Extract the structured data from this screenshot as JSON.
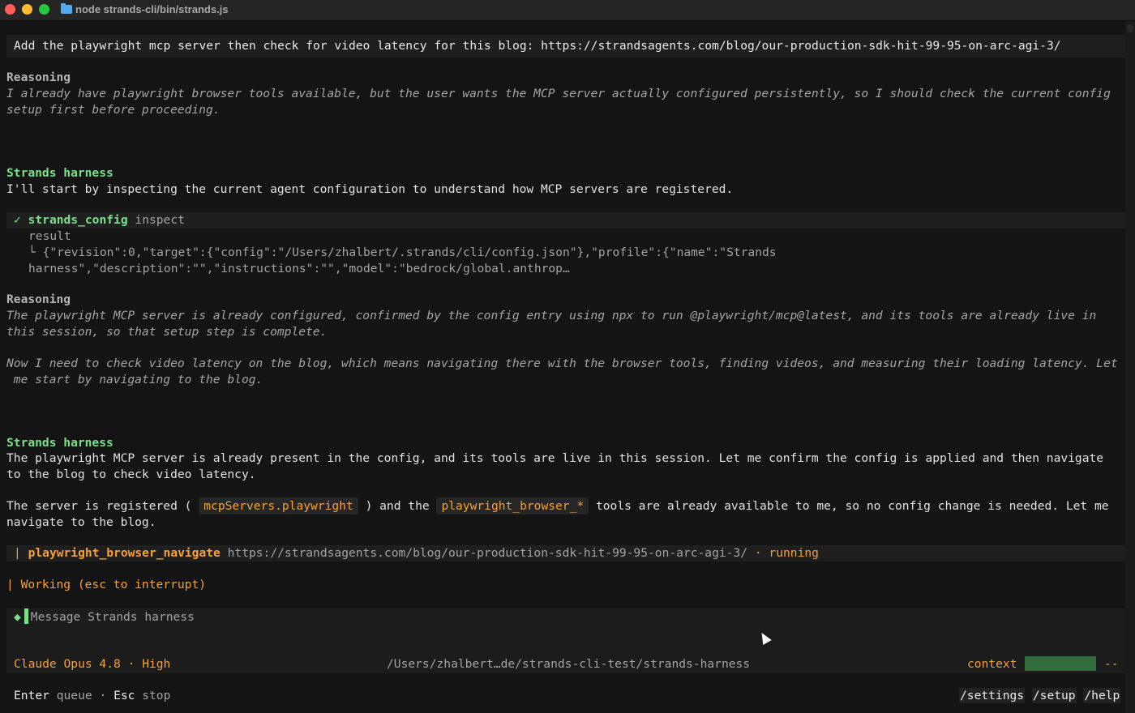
{
  "window": {
    "title": "node strands-cli/bin/strands.js",
    "folder_icon": "folder-icon"
  },
  "conversation": {
    "user_prompt": "Add the playwright mcp server then check for video latency for this blog: https://strandsagents.com/blog/our-production-sdk-hit-99-95-on-arc-agi-3/",
    "reasoning_1": {
      "heading": "Reasoning",
      "lines": [
        "I already have playwright browser tools available, but the user wants the MCP server actually configured persistently, so I should check the current config",
        "setup first before proceeding."
      ]
    },
    "agent_1": {
      "name": "Strands harness",
      "text": "I'll start by inspecting the current agent configuration to understand how MCP servers are registered."
    },
    "tool_1": {
      "check": "✓",
      "name": "strands_config",
      "action": "inspect",
      "result_label": "result",
      "corner": "└",
      "result_lines": [
        "{\"revision\":0,\"target\":{\"config\":\"/Users/zhalbert/.strands/cli/config.json\"},\"profile\":{\"name\":\"Strands",
        "harness\",\"description\":\"\",\"instructions\":\"\",\"model\":\"bedrock/global.anthrop…"
      ]
    },
    "reasoning_2": {
      "heading": "Reasoning",
      "lines": [
        "The playwright MCP server is already configured, confirmed by the config entry using npx to run @playwright/mcp@latest, and its tools are already live in",
        "this session, so that setup step is complete.",
        "Now I need to check video latency on the blog, which means navigating there with the browser tools, finding videos, and measuring their loading latency. Let",
        " me start by navigating to the blog."
      ]
    },
    "agent_2": {
      "name": "Strands harness",
      "lines": [
        "The playwright MCP server is already present in the config, and its tools are live in this session. Let me confirm the config is applied and then navigate",
        "to the blog to check video latency."
      ],
      "p2_a": "The server is registered (",
      "p2_code1": "mcpServers.playwright",
      "p2_b": ") and the",
      "p2_code2": "playwright_browser_*",
      "p2_c": "tools are already available to me, so no config change is needed. Let me",
      "p2_line2": "navigate to the blog."
    },
    "tool_2": {
      "bar": "|",
      "name": "playwright_browser_navigate",
      "url": "https://strandsagents.com/blog/our-production-sdk-hit-99-95-on-arc-agi-3/",
      "sep": "·",
      "status": "running"
    },
    "working": "| Working (esc to interrupt)"
  },
  "composer": {
    "diamond": "◆",
    "placeholder": "Message Strands harness"
  },
  "status_bar": {
    "model": "Claude Opus 4.8",
    "sep": "·",
    "effort": "High",
    "path": "/Users/zhalbert…de/strands-cli-test/strands-harness",
    "context_label": "context",
    "context_value": "--"
  },
  "footer": {
    "enter_key": "Enter",
    "enter_action": "queue",
    "sep": "·",
    "esc_key": "Esc",
    "esc_action": "stop",
    "commands": [
      "/settings",
      "/setup",
      "/help"
    ]
  },
  "colors": {
    "accent_green": "#7be08a",
    "accent_orange": "#f5a03a",
    "background": "#141414"
  }
}
